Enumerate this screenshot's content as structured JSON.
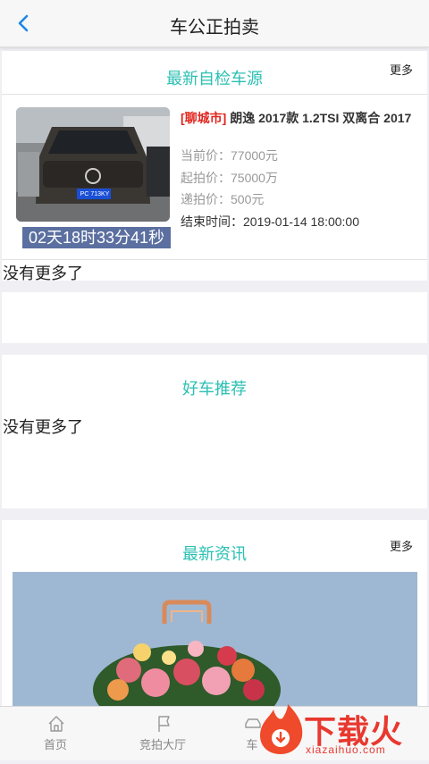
{
  "header": {
    "title": "车公正拍卖"
  },
  "section_latest": {
    "title": "最新自检车源",
    "more": "更多",
    "car": {
      "city": "[聊城市]",
      "name": "朗逸 2017款 1.2TSI 双离合 2017",
      "current_price": "当前价：77000元",
      "start_price": "起拍价：75000万",
      "increment": "递拍价：500元",
      "end_time": "结束时间：2019-01-14 18:00:00",
      "countdown": "02天18时33分41秒",
      "plate": "PC 713KY"
    },
    "no_more": "没有更多了"
  },
  "section_recommend": {
    "title": "好车推荐",
    "no_more": "没有更多了"
  },
  "section_news": {
    "title": "最新资讯",
    "more": "更多"
  },
  "tabbar": {
    "items": [
      {
        "label": "首页",
        "icon": "home-icon"
      },
      {
        "label": "竞拍大厅",
        "icon": "flag-icon"
      },
      {
        "label": "车",
        "icon": "car-icon"
      }
    ]
  },
  "watermark": {
    "text": "下载火",
    "url": "xiazaihuo.com"
  },
  "colors": {
    "accent": "#2bc0b3",
    "city_red": "#e0261f",
    "countdown_bg": "#5b6fa0",
    "back_blue": "#1e88e5"
  }
}
